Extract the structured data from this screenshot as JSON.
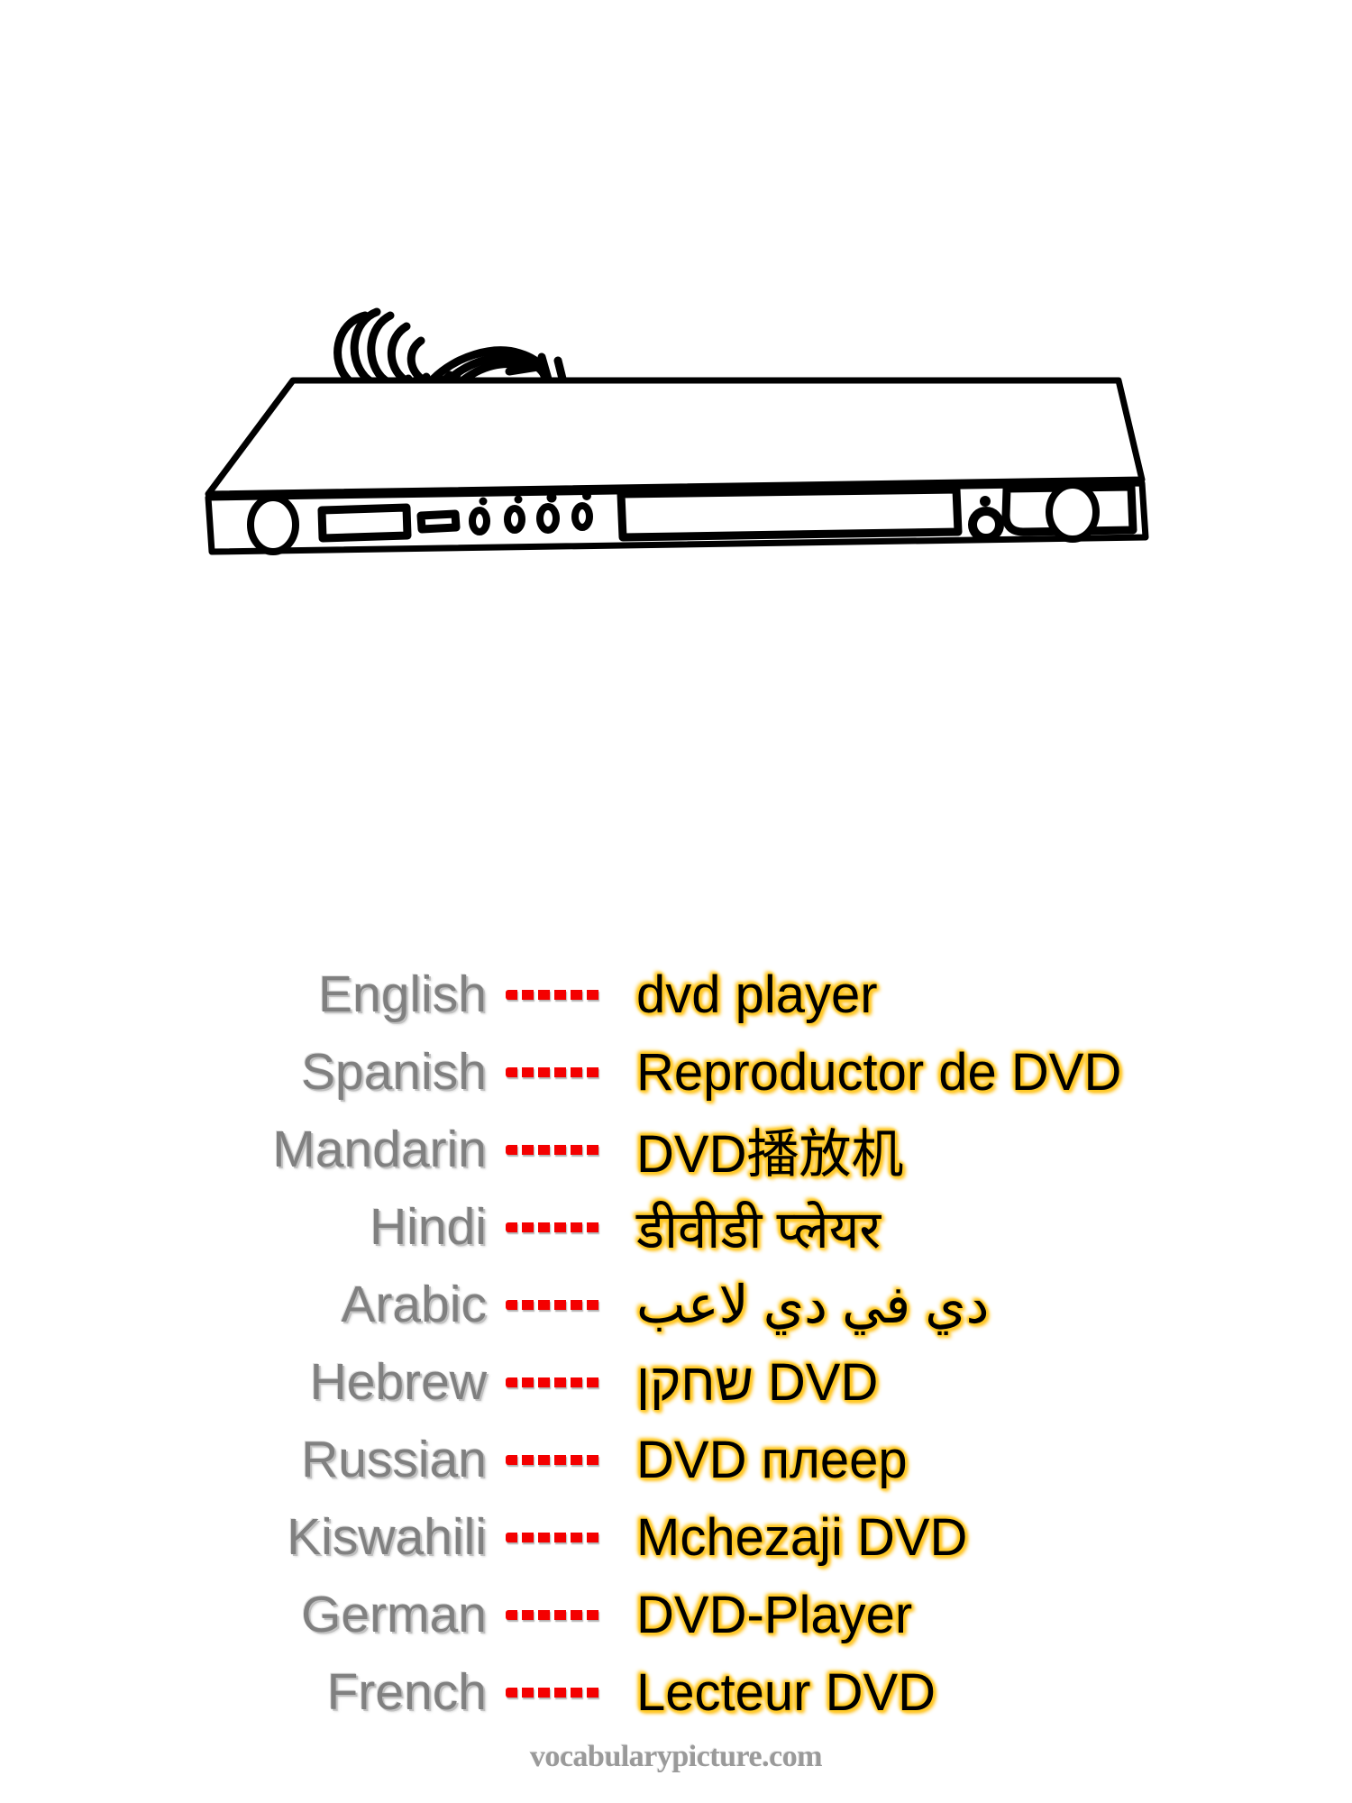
{
  "illustration": {
    "subject": "dvd-player",
    "description": "Black-and-white line drawing of a slim DVD player in perspective, with a coiled power cable resting behind it",
    "stroke_color": "#000000",
    "fill_color": "#ffffff",
    "parts": [
      "top-panel",
      "front-panel",
      "power-button",
      "display-window",
      "small-indicator",
      "control-button-1",
      "control-button-2",
      "control-button-3",
      "control-button-4",
      "disc-tray",
      "eject-button",
      "right-knob",
      "power-cable-coil"
    ]
  },
  "vocabulary": {
    "separator": "------",
    "rows": [
      {
        "language": "English",
        "term": "dvd player",
        "rtl": false
      },
      {
        "language": "Spanish",
        "term": "Reproductor de DVD",
        "rtl": false
      },
      {
        "language": "Mandarin",
        "term": "DVD播放机",
        "rtl": false
      },
      {
        "language": "Hindi",
        "term": "डीवीडी प्लेयर",
        "rtl": false
      },
      {
        "language": "Arabic",
        "term": "دي في دي لاعب",
        "rtl": true
      },
      {
        "language": "Hebrew",
        "term": "שחקן DVD",
        "rtl": true
      },
      {
        "language": "Russian",
        "term": "DVD плеер",
        "rtl": false
      },
      {
        "language": "Kiswahili",
        "term": "Mchezaji DVD",
        "rtl": false
      },
      {
        "language": "German",
        "term": "DVD-Player",
        "rtl": false
      },
      {
        "language": "French",
        "term": "Lecteur DVD",
        "rtl": false
      }
    ]
  },
  "footer": {
    "watermark": "vocabularypicture.com"
  },
  "colors": {
    "language_label": "#808080",
    "term_text": "#000000",
    "term_glow": "#ffc61a",
    "separator_dash": "#f40000",
    "watermark": "#9a9a9a",
    "background": "#ffffff"
  }
}
